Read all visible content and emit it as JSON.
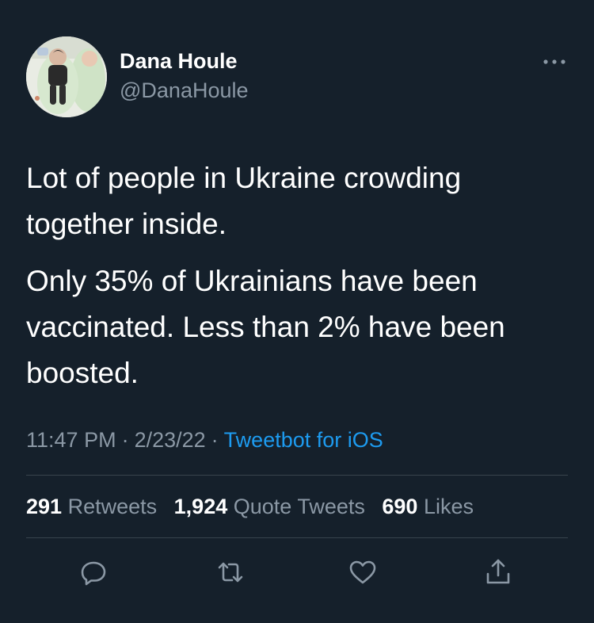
{
  "author": {
    "display_name": "Dana Houle",
    "handle": "@DanaHoule",
    "avatar_icon": "avatar-photo"
  },
  "tweet": {
    "paragraphs": [
      "Lot of people in Ukraine crowding together inside.",
      "Only 35% of Ukrainians have been vaccinated. Less than 2% have been boosted."
    ]
  },
  "meta": {
    "time": "11:47 PM",
    "date": "2/23/22",
    "separator": "·",
    "source": "Tweetbot for iOS"
  },
  "stats": {
    "retweets_count": "291",
    "retweets_label": "Retweets",
    "quotes_count": "1,924",
    "quotes_label": "Quote Tweets",
    "likes_count": "690",
    "likes_label": "Likes"
  },
  "icons": {
    "more": "more-icon",
    "reply": "reply-icon",
    "retweet": "retweet-icon",
    "like": "heart-icon",
    "share": "share-icon"
  },
  "colors": {
    "background": "#15202b",
    "primary_text": "#ffffff",
    "secondary_text": "#8b98a5",
    "accent": "#1d9bf0",
    "divider": "#38444d"
  }
}
